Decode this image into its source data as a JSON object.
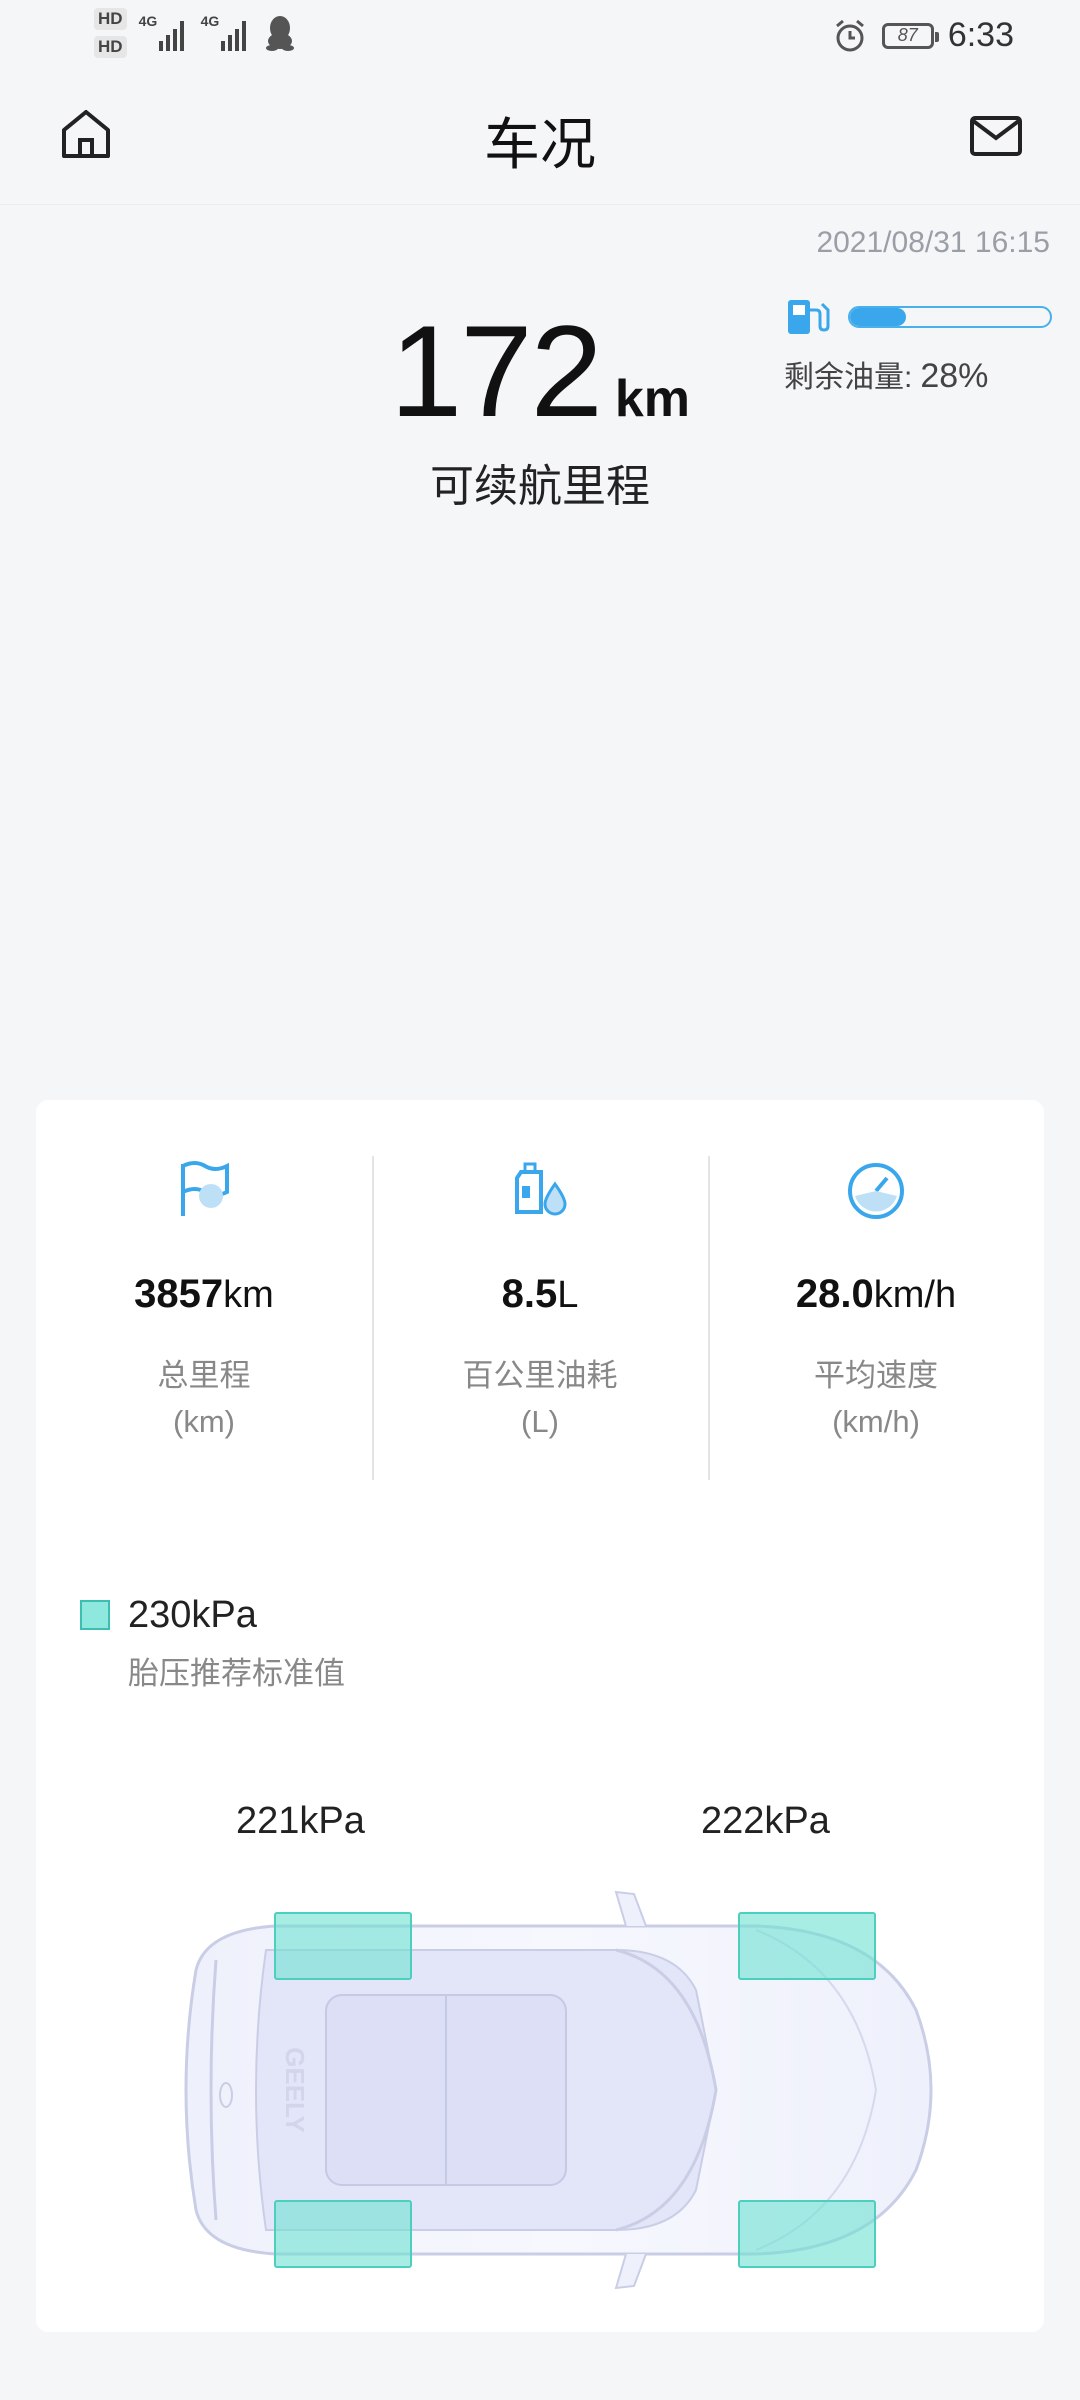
{
  "status_bar": {
    "hd1": "HD",
    "hd2": "HD",
    "net1": "4G",
    "net2": "4G",
    "battery": "87",
    "time": "6:33"
  },
  "header": {
    "title": "车况"
  },
  "range": {
    "timestamp": "2021/08/31 16:15",
    "value": "172",
    "unit": "km",
    "label": "可续航里程"
  },
  "fuel": {
    "label": "剩余油量:",
    "percent_text": "28%",
    "level": 0.28
  },
  "stats": [
    {
      "value": "3857",
      "unit": "km",
      "label": "总里程",
      "sub": "(km)",
      "icon": "flag-icon"
    },
    {
      "value": "8.5",
      "unit": "L",
      "label": "百公里油耗",
      "sub": "(L)",
      "icon": "fuel-consumption-icon"
    },
    {
      "value": "28.0",
      "unit": "km/h",
      "label": "平均速度",
      "sub": "(km/h)",
      "icon": "speedometer-icon"
    }
  ],
  "tire": {
    "standard_value": "230kPa",
    "standard_label": "胎压推荐标准值",
    "left_value": "221kPa",
    "right_value": "222kPa",
    "car_logo": "GEELY"
  },
  "colors": {
    "accent": "#3aa7ec",
    "tire_highlight": "#8ee8dd"
  }
}
